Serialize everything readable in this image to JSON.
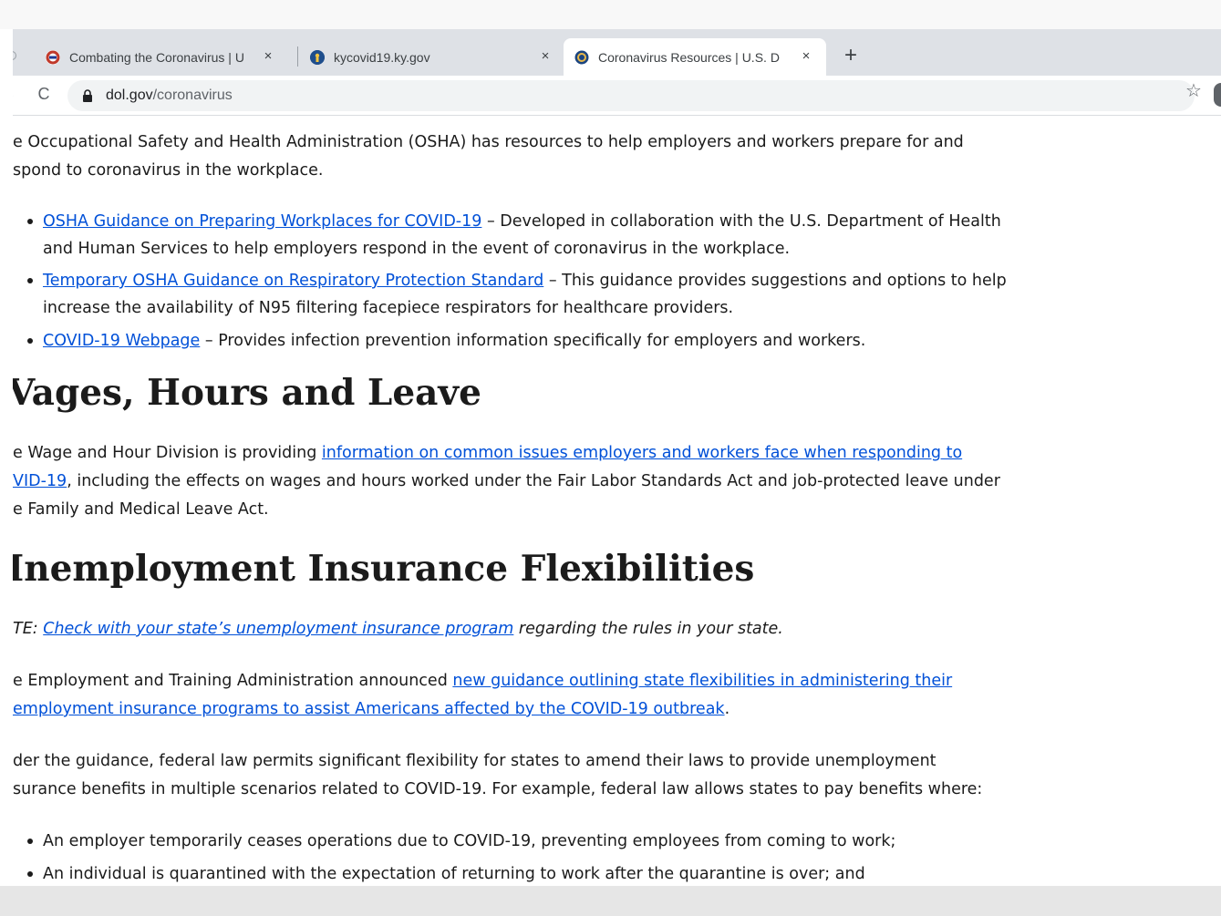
{
  "browser": {
    "tabs": [
      {
        "title": "Combating the Coronavirus | U",
        "icon": "whitehouse-favicon-icon",
        "close": "×"
      },
      {
        "title": "kycovid19.ky.gov",
        "icon": "kentucky-favicon-icon",
        "close": "×"
      },
      {
        "title": "Coronavirus Resources | U.S. D",
        "icon": "dol-seal-favicon-icon",
        "close": "×",
        "active": true
      }
    ],
    "new_tab": "+",
    "url_domain": "dol.gov",
    "url_path": "/coronavirus",
    "bookmark_icon": "☆",
    "reload_icon": "C"
  },
  "page": {
    "osha_intro": {
      "line1": "e Occupational Safety and Health Administration (OSHA) has resources to help employers and workers prepare for and",
      "line2": "spond to coronavirus in the workplace."
    },
    "osha_links": [
      {
        "link": "OSHA Guidance on Preparing Workplaces for COVID-19",
        "rest1": " – Developed in collaboration with the U.S. Department of Health",
        "line2": "and Human Services to help employers respond in the event of coronavirus in the workplace."
      },
      {
        "link": "Temporary OSHA Guidance on Respiratory Protection Standard",
        "rest1": " – This guidance provides suggestions and options to help",
        "line2": "increase the availability of N95 filtering facepiece respirators for healthcare providers."
      },
      {
        "link": "COVID-19 Webpage",
        "rest1": " – Provides infection prevention information specifically for employers and workers."
      }
    ],
    "wages_heading": "Vages, Hours and Leave",
    "wages": {
      "line1_pre": "e Wage and Hour Division is providing ",
      "line1_link": "information on common issues employers and workers face when responding to",
      "line2_link": "VID-19",
      "line2_rest": ", including the effects on wages and hours worked under the Fair Labor Standards Act and job-protected leave under",
      "line3": "e Family and Medical Leave Act."
    },
    "ui_heading": "Inemployment Insurance Flexibilities",
    "note": {
      "pre": "TE: ",
      "link": "Check with your state’s unemployment insurance program",
      "post": " regarding the rules in your state."
    },
    "eta": {
      "line1_pre": "e Employment and Training Administration announced ",
      "line1_link": "new guidance outlining state flexibilities in administering their",
      "line2_link": "employment insurance programs to assist Americans affected by the COVID-19 outbreak",
      "line2_post": "."
    },
    "guidance": {
      "line1": "der the guidance, federal law permits significant flexibility for states to amend their laws to provide unemployment",
      "line2": "surance benefits in multiple scenarios related to COVID-19. For example, federal law allows states to pay benefits where:"
    },
    "scenarios": [
      "An employer temporarily ceases operations due to COVID-19, preventing employees from coming to work;",
      "An individual is quarantined with the expectation of returning to work after the quarantine is over; and"
    ]
  },
  "colors": {
    "link": "#0050d8",
    "text": "#1b1b1b",
    "tabstrip": "#dee1e6",
    "omnibox": "#f1f3f4"
  }
}
